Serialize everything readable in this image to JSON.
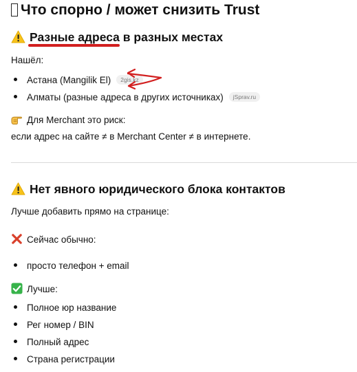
{
  "title": "Что спорно / может снизить Trust",
  "section1": {
    "heading_underlined": "Разные адреса",
    "heading_rest": "в разных местах",
    "intro": "Нашёл:",
    "items": [
      {
        "text": "Астана (Mangilik El)",
        "source": "2gis.kz"
      },
      {
        "text": "Алматы (разные адреса в других источниках)",
        "source": "jSprav.ru"
      }
    ],
    "risk_label": "Для Merchant это риск:",
    "risk_text": "если адрес на сайте ≠ в Merchant Center ≠ в интернете."
  },
  "section2": {
    "heading": "Нет явного юридического блока контактов",
    "intro": "Лучше добавить прямо на странице:",
    "now_label": "Сейчас обычно:",
    "now_items": [
      "просто телефон + email"
    ],
    "better_label": "Лучше:",
    "better_items": [
      "Полное юр название",
      "Рег номер / BIN",
      "Полный адрес",
      "Страна регистрации"
    ]
  },
  "colors": {
    "warning": "#f7c21b",
    "annotation_red": "#d21f1f",
    "cross_red": "#d9402b",
    "check_green": "#37b34a",
    "hand_yellow": "#f6c04a"
  },
  "icons": [
    "warning-icon",
    "pointing-hand-icon",
    "cross-mark-icon",
    "check-mark-icon",
    "missing-glyph-icon"
  ]
}
